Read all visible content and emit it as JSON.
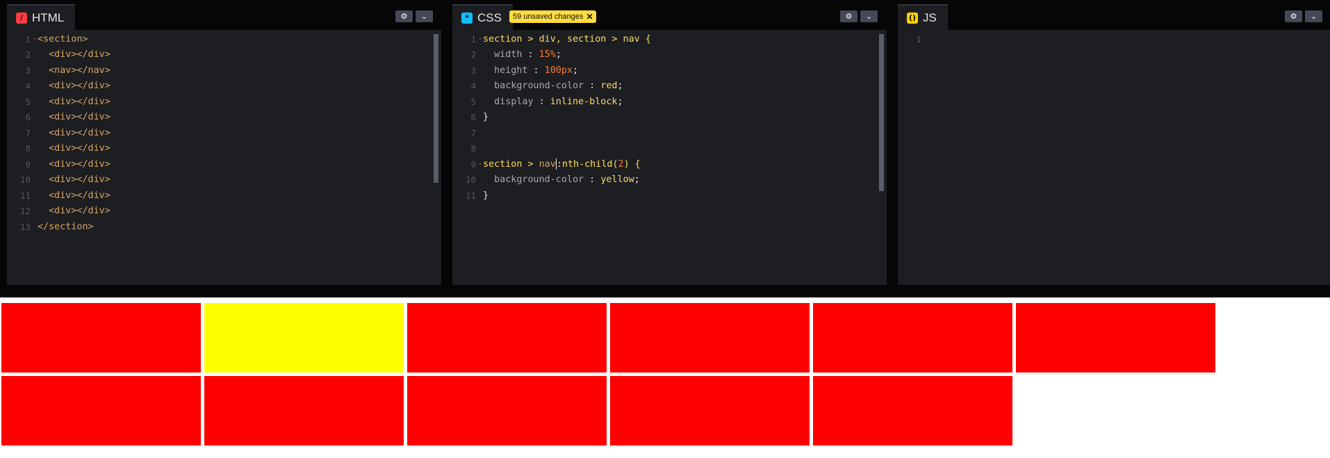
{
  "panes": {
    "html": {
      "label": "HTML",
      "icon": "html-file-icon",
      "icon_glyph": "/",
      "icon_color": "#ff3c41",
      "lines": [
        [
          {
            "t": "<section>",
            "c": "tag"
          }
        ],
        [
          {
            "t": "  <div></div>",
            "c": "tag"
          }
        ],
        [
          {
            "t": "  <nav></nav>",
            "c": "tag"
          }
        ],
        [
          {
            "t": "  <div></div>",
            "c": "tag"
          }
        ],
        [
          {
            "t": "  <div></div>",
            "c": "tag"
          }
        ],
        [
          {
            "t": "  <div></div>",
            "c": "tag"
          }
        ],
        [
          {
            "t": "  <div></div>",
            "c": "tag"
          }
        ],
        [
          {
            "t": "  <div></div>",
            "c": "tag"
          }
        ],
        [
          {
            "t": "  <div></div>",
            "c": "tag"
          }
        ],
        [
          {
            "t": "  <div></div>",
            "c": "tag"
          }
        ],
        [
          {
            "t": "  <div></div>",
            "c": "tag"
          }
        ],
        [
          {
            "t": "  <div></div>",
            "c": "tag"
          }
        ],
        [
          {
            "t": "</section>",
            "c": "tag"
          }
        ]
      ]
    },
    "css": {
      "label": "CSS",
      "icon": "css-file-icon",
      "icon_glyph": "*",
      "icon_color": "#0ebeff",
      "badge": "59 unsaved changes",
      "lines": [
        [
          {
            "t": "section > div, section > nav {",
            "c": "sel"
          }
        ],
        [
          {
            "t": "  width",
            "c": "prop"
          },
          {
            "t": " : ",
            "c": "punc"
          },
          {
            "t": "15%",
            "c": "num"
          },
          {
            "t": ";",
            "c": "punc"
          }
        ],
        [
          {
            "t": "  height",
            "c": "prop"
          },
          {
            "t": " : ",
            "c": "punc"
          },
          {
            "t": "100px",
            "c": "num"
          },
          {
            "t": ";",
            "c": "punc"
          }
        ],
        [
          {
            "t": "  background-color",
            "c": "prop"
          },
          {
            "t": " : ",
            "c": "punc"
          },
          {
            "t": "red",
            "c": "val"
          },
          {
            "t": ";",
            "c": "punc"
          }
        ],
        [
          {
            "t": "  display",
            "c": "prop"
          },
          {
            "t": " : ",
            "c": "punc"
          },
          {
            "t": "inline-block",
            "c": "val"
          },
          {
            "t": ";",
            "c": "punc"
          }
        ],
        [
          {
            "t": "}",
            "c": "punc"
          }
        ],
        [],
        [],
        [
          {
            "t": "section > ",
            "c": "sel"
          },
          {
            "t": "nav",
            "c": "tag"
          },
          {
            "t": "|",
            "c": "cursor"
          },
          {
            "t": ":nth-child(",
            "c": "sel"
          },
          {
            "t": "2",
            "c": "num"
          },
          {
            "t": ") {",
            "c": "sel"
          }
        ],
        [
          {
            "t": "  background-color",
            "c": "prop"
          },
          {
            "t": " : ",
            "c": "punc"
          },
          {
            "t": "yellow",
            "c": "val"
          },
          {
            "t": ";",
            "c": "punc"
          }
        ],
        [
          {
            "t": "}",
            "c": "punc"
          }
        ]
      ]
    },
    "js": {
      "label": "JS",
      "icon": "js-file-icon",
      "icon_glyph": "()",
      "icon_color": "#fcd000",
      "lines": [
        []
      ]
    }
  },
  "controls": {
    "settings_icon": "gear-icon",
    "settings_glyph": "⚙",
    "collapse_icon": "chevron-down-icon",
    "collapse_glyph": "⌄"
  },
  "preview": {
    "boxes": [
      {
        "color": "#ff0000"
      },
      {
        "color": "#ffff00"
      },
      {
        "color": "#ff0000"
      },
      {
        "color": "#ff0000"
      },
      {
        "color": "#ff0000"
      },
      {
        "color": "#ff0000"
      },
      {
        "color": "#ff0000"
      },
      {
        "color": "#ff0000"
      },
      {
        "color": "#ff0000"
      },
      {
        "color": "#ff0000"
      },
      {
        "color": "#ff0000"
      }
    ]
  }
}
